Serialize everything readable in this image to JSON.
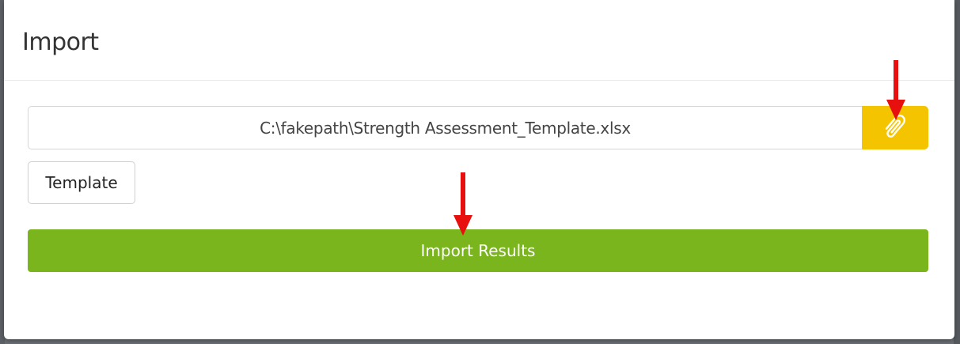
{
  "dialog": {
    "title": "Import"
  },
  "file_input": {
    "value": "C:\\fakepath\\Strength Assessment_Template.xlsx"
  },
  "buttons": {
    "attach_icon": "paperclip-icon",
    "template_label": "Template",
    "import_label": "Import Results"
  },
  "colors": {
    "attach_button": "#f5c400",
    "import_button": "#7ab51d",
    "annotation_arrow": "#e8100f"
  }
}
